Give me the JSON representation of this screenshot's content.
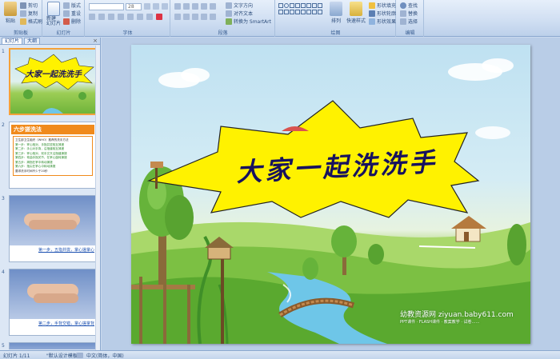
{
  "ribbon": {
    "clipboard": {
      "paste": "粘贴",
      "cut": "剪切",
      "copy": "复制",
      "format_painter": "格式刷",
      "label": "剪贴板"
    },
    "slides": {
      "new_slide": "新建\n幻灯片",
      "layout": "版式",
      "reset": "重设",
      "delete": "删除",
      "label": "幻灯片"
    },
    "font": {
      "size": "28",
      "label": "字体"
    },
    "paragraph": {
      "text_direction": "文字方向",
      "align_text": "对齐文本",
      "smartart": "转换为 SmartArt",
      "label": "段落"
    },
    "drawing": {
      "arrange": "排列",
      "quick_styles": "快速样式",
      "fill": "形状填充",
      "outline": "形状轮廓",
      "effects": "形状效果",
      "label": "绘图"
    },
    "editing": {
      "find": "查找",
      "replace": "替换",
      "select": "选择",
      "label": "编辑"
    }
  },
  "panel": {
    "tabs": {
      "slides": "幻灯片",
      "outline": "大纲"
    },
    "close": "×",
    "slide_numbers": [
      "1",
      "2",
      "3",
      "4",
      "5"
    ],
    "thumb1_title": "大家一起洗洗手",
    "thumb2": {
      "heading": "六步搓洗法",
      "intro": "卫生部卫生组织（WHO）推荐的洗手方法",
      "steps": [
        "第一步：掌心相对，手指并拢相互揉搓",
        "第二步：手心对手背，沿指缝相互揉搓",
        "第三步：掌心相对，双手交叉沿指缝揉搓",
        "第四步：弯曲手指关节，在掌心旋转揉搓",
        "第五步：拇指在掌中转动揉搓",
        "第六步：指尖在掌心中转动揉搓"
      ],
      "note": "要求洗手时间不少于20秒"
    },
    "thumb3_caption": "第一步，五指并拢，掌心搓掌心",
    "thumb4_caption": "第二步，手背交错，掌心搓掌背"
  },
  "slide": {
    "title": "大家一起洗洗手",
    "watermark_line1": "幼教资源网 ziyuan.baby611.com",
    "watermark_line2": "PPT课件 · FLASH课件 · 教案教学 · 试卷……"
  },
  "status": {
    "slide_count": "幻灯片 1/11",
    "theme": "\"默认设计模板\"",
    "language": "中文(简体，中国)"
  },
  "colors": {
    "accent_orange": "#f5a13a",
    "starburst": "#fff200",
    "title_ink": "#17125e"
  }
}
